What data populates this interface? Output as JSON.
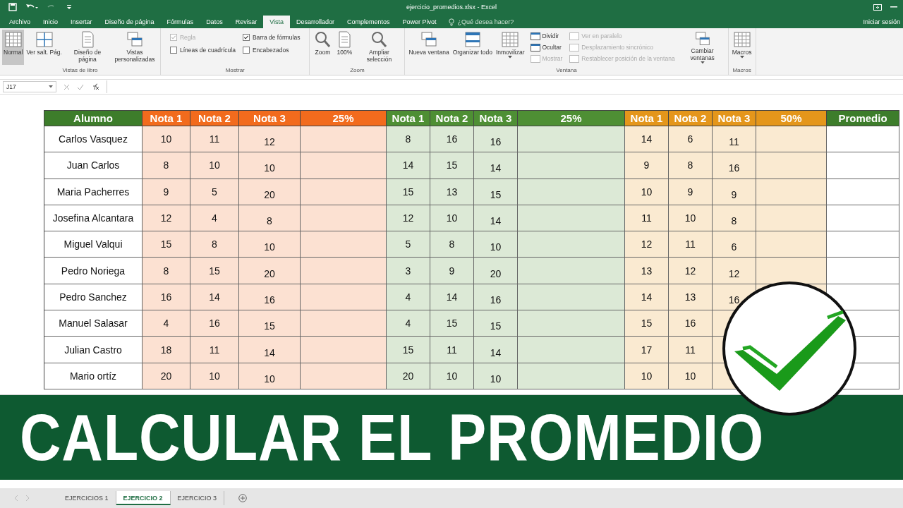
{
  "window": {
    "title": "ejercicio_promedios.xlsx - Excel"
  },
  "ribbon_tabs": [
    {
      "label": "Archivo",
      "selected": false
    },
    {
      "label": "Inicio",
      "selected": false
    },
    {
      "label": "Insertar",
      "selected": false
    },
    {
      "label": "Diseño de página",
      "selected": false
    },
    {
      "label": "Fórmulas",
      "selected": false
    },
    {
      "label": "Datos",
      "selected": false
    },
    {
      "label": "Revisar",
      "selected": false
    },
    {
      "label": "Vista",
      "selected": true
    },
    {
      "label": "Desarrollador",
      "selected": false
    },
    {
      "label": "Complementos",
      "selected": false
    },
    {
      "label": "Power Pivot",
      "selected": false
    }
  ],
  "tell_me": {
    "placeholder": "¿Qué desea hacer?"
  },
  "sign_in": "Iniciar sesión",
  "ribbon": {
    "groups": [
      {
        "label": "Vistas de libro",
        "items": [
          {
            "kind": "large",
            "label": "Normal",
            "selected": true
          },
          {
            "kind": "large",
            "label": "Ver salt. Pág.",
            "selected": false
          },
          {
            "kind": "large",
            "label": "Diseño de página",
            "selected": false
          },
          {
            "kind": "large",
            "label": "Vistas personalizadas",
            "selected": false
          }
        ]
      },
      {
        "label": "Mostrar",
        "items": [
          {
            "kind": "check",
            "label": "Regla",
            "checked": true,
            "disabled": true
          },
          {
            "kind": "check",
            "label": "Barra de fórmulas",
            "checked": true,
            "disabled": false
          },
          {
            "kind": "check",
            "label": "Líneas de cuadrícula",
            "checked": false,
            "disabled": false
          },
          {
            "kind": "check",
            "label": "Encabezados",
            "checked": false,
            "disabled": false
          }
        ]
      },
      {
        "label": "Zoom",
        "items": [
          {
            "kind": "large",
            "label": "Zoom",
            "selected": false
          },
          {
            "kind": "large",
            "label": "100%",
            "selected": false
          },
          {
            "kind": "large",
            "label": "Ampliar selección",
            "selected": false
          }
        ]
      },
      {
        "label": "Ventana",
        "items": [
          {
            "kind": "large",
            "label": "Nueva ventana",
            "selected": false
          },
          {
            "kind": "large",
            "label": "Organizar todo",
            "selected": false
          },
          {
            "kind": "dropdown",
            "label": "Inmovilizar",
            "selected": false
          },
          {
            "kind": "small",
            "label": "Dividir",
            "disabled": false
          },
          {
            "kind": "small",
            "label": "Ocultar",
            "disabled": false
          },
          {
            "kind": "small",
            "label": "Mostrar",
            "disabled": true
          },
          {
            "kind": "small",
            "label": "Ver en paralelo",
            "disabled": true
          },
          {
            "kind": "small",
            "label": "Desplazamiento sincrónico",
            "disabled": true
          },
          {
            "kind": "small",
            "label": "Restablecer posición de la ventana",
            "disabled": true
          },
          {
            "kind": "dropdown",
            "label": "Cambiar ventanas",
            "selected": false
          }
        ]
      },
      {
        "label": "Macros",
        "items": [
          {
            "kind": "dropdown",
            "label": "Macros",
            "selected": false
          }
        ]
      }
    ]
  },
  "formula_bar": {
    "name_box": "J17"
  },
  "table": {
    "columns": [
      {
        "label": "Alumno",
        "color": "#3d7d2b"
      },
      {
        "label": "Nota 1",
        "color": "#f26b1d"
      },
      {
        "label": "Nota 2",
        "color": "#f26b1d"
      },
      {
        "label": "Nota 3",
        "color": "#f26b1d"
      },
      {
        "label": "25%",
        "color": "#f26b1d"
      },
      {
        "label": "Nota 1",
        "color": "#4e8f34"
      },
      {
        "label": "Nota 2",
        "color": "#4e8f34"
      },
      {
        "label": "Nota 3",
        "color": "#4e8f34"
      },
      {
        "label": "25%",
        "color": "#4e8f34"
      },
      {
        "label": "Nota 1",
        "color": "#e4961b"
      },
      {
        "label": "Nota 2",
        "color": "#e4961b"
      },
      {
        "label": "Nota 3",
        "color": "#e4961b"
      },
      {
        "label": "50%",
        "color": "#e4961b"
      },
      {
        "label": "Promedio",
        "color": "#3d7d2b"
      }
    ],
    "rows": [
      {
        "name": "Carlos Vasquez",
        "groups": [
          [
            "10",
            "11",
            "12"
          ],
          [
            "8",
            "16",
            "16"
          ],
          [
            "14",
            "6",
            "11"
          ]
        ]
      },
      {
        "name": "Juan Carlos",
        "groups": [
          [
            "8",
            "10",
            "10"
          ],
          [
            "14",
            "15",
            "14"
          ],
          [
            "9",
            "8",
            "16"
          ]
        ]
      },
      {
        "name": "Maria Pacherres",
        "groups": [
          [
            "9",
            "5",
            "20"
          ],
          [
            "15",
            "13",
            "15"
          ],
          [
            "10",
            "9",
            "9"
          ]
        ]
      },
      {
        "name": "Josefina Alcantara",
        "groups": [
          [
            "12",
            "4",
            "8"
          ],
          [
            "12",
            "10",
            "14"
          ],
          [
            "11",
            "10",
            "8"
          ]
        ]
      },
      {
        "name": "Miguel Valqui",
        "groups": [
          [
            "15",
            "8",
            "10"
          ],
          [
            "5",
            "8",
            "10"
          ],
          [
            "12",
            "11",
            "6"
          ]
        ]
      },
      {
        "name": "Pedro Noriega",
        "groups": [
          [
            "8",
            "15",
            "20"
          ],
          [
            "3",
            "9",
            "20"
          ],
          [
            "13",
            "12",
            "12"
          ]
        ]
      },
      {
        "name": "Pedro Sanchez",
        "groups": [
          [
            "16",
            "14",
            "16"
          ],
          [
            "4",
            "14",
            "16"
          ],
          [
            "14",
            "13",
            "16"
          ]
        ]
      },
      {
        "name": "Manuel Salasar",
        "groups": [
          [
            "4",
            "16",
            "15"
          ],
          [
            "4",
            "15",
            "15"
          ],
          [
            "15",
            "16"
          ]
        ]
      },
      {
        "name": "Julian Castro",
        "groups": [
          [
            "18",
            "11",
            "14"
          ],
          [
            "15",
            "11",
            "14"
          ],
          [
            "17",
            "11"
          ]
        ]
      },
      {
        "name": "Mario ortíz",
        "groups": [
          [
            "20",
            "10",
            "10"
          ],
          [
            "20",
            "10",
            "10"
          ],
          [
            "10",
            "10"
          ]
        ]
      }
    ]
  },
  "banner": {
    "title": "CALCULAR EL PROMEDIO"
  },
  "sheet_tabs": [
    {
      "label": "EJERCICIOS 1",
      "selected": false
    },
    {
      "label": "EJERCICIO 2",
      "selected": true
    },
    {
      "label": "EJERCICIO 3",
      "selected": false
    }
  ]
}
